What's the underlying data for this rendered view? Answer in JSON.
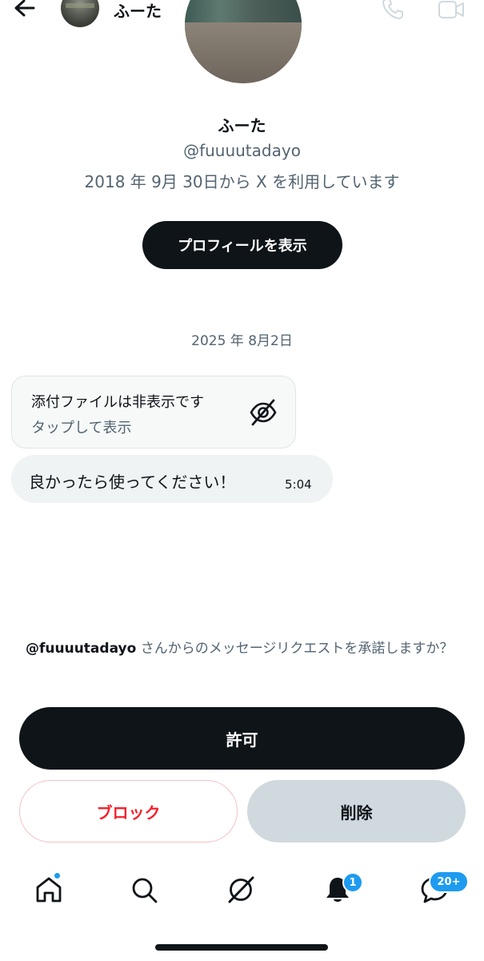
{
  "header": {
    "contact_name": "ふーた"
  },
  "profile": {
    "name": "ふーた",
    "handle": "@fuuuutadayo",
    "joined": "2018 年 9月 30日から X を利用しています",
    "view_profile_label": "プロフィールを表示"
  },
  "conversation": {
    "date_divider": "2025 年 8月2日",
    "attachment": {
      "title": "添付ファイルは非表示です",
      "tap_label": "タップして表示"
    },
    "message": {
      "text": "良かったら使ってください！",
      "time": "5:04"
    }
  },
  "request": {
    "handle": "@fuuuutadayo",
    "prompt_rest": " さんからのメッセージリクエストを承諾しますか？",
    "allow_label": "許可",
    "block_label": "ブロック",
    "delete_label": "削除"
  },
  "bottom_nav": {
    "notifications_badge": "1",
    "messages_badge": "20+"
  },
  "colors": {
    "accent": "#1d9bf0",
    "primary_dark": "#0f1419",
    "danger": "#f4212e",
    "secondary_text": "#536471"
  },
  "icons": [
    "back-arrow-icon",
    "phone-icon",
    "video-icon",
    "eye-off-icon",
    "home-icon",
    "search-icon",
    "grok-icon",
    "bell-icon",
    "messages-icon"
  ]
}
